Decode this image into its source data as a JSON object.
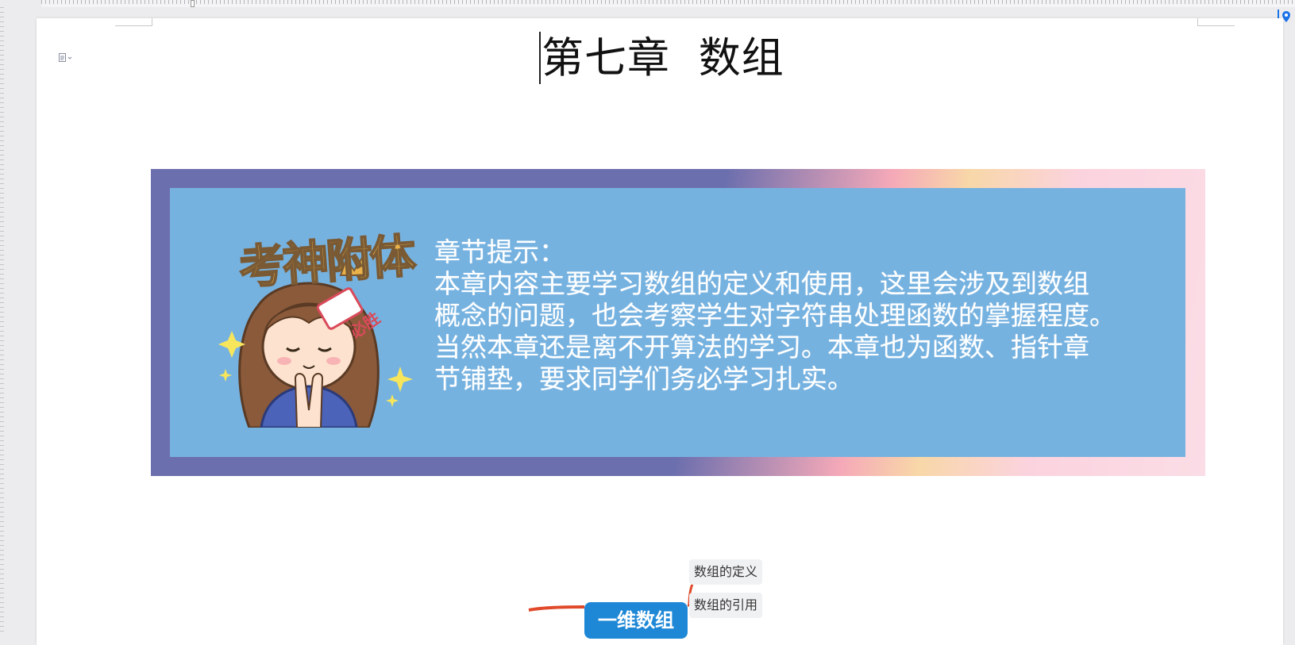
{
  "document": {
    "title": "第七章  数组"
  },
  "banner": {
    "illustration_caption": "考神附体",
    "headband_text": "必胜",
    "heading": "章节提示：",
    "lines": [
      "本章内容主要学习数组的定义和使用，这里会涉及到数组",
      "概念的问题，也会考察学生对字符串处理函数的掌握程度。",
      "当然本章还是离不开算法的学习。本章也为函数、指针章",
      "节铺垫，要求同学们务必学习扎实。"
    ]
  },
  "mind_map": {
    "node": "一维数组",
    "leaves": [
      "数组的定义",
      "数组的引用"
    ]
  },
  "colors": {
    "banner_frame": "#6c6fae",
    "banner_inner": "#76b2e0",
    "node": "#1f88d6",
    "branch": "#e04a2a"
  },
  "icons": [
    "document-icon",
    "location-pin-icon"
  ]
}
